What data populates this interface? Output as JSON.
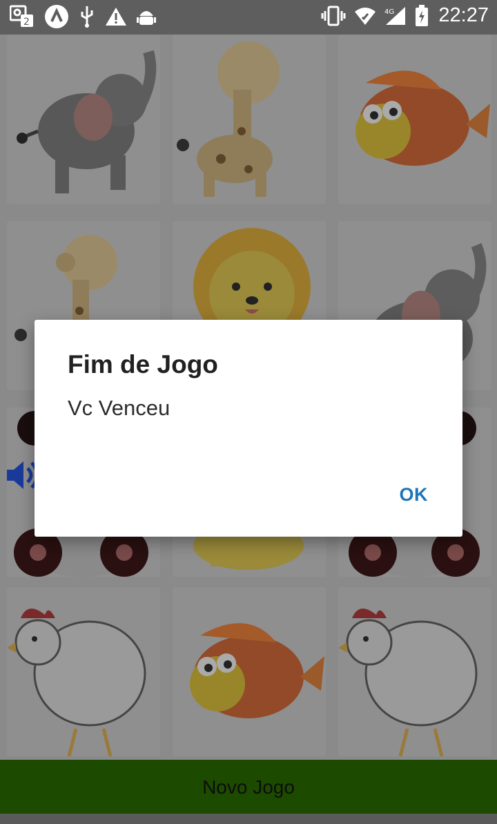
{
  "status_bar": {
    "network_label": "4G",
    "time": "22:27"
  },
  "dialog": {
    "title": "Fim de Jogo",
    "message": "Vc Venceu",
    "ok_label": "OK"
  },
  "board": {
    "cards": [
      "elephant",
      "giraffe",
      "fish",
      "giraffe",
      "lion",
      "elephant",
      "panda",
      "lion",
      "panda",
      "hen",
      "fish",
      "hen"
    ]
  },
  "new_game_label": "Novo Jogo",
  "colors": {
    "accent": "#1e74b8",
    "button_bg": "#1c4b00",
    "scrim": "#7d7d7d"
  }
}
